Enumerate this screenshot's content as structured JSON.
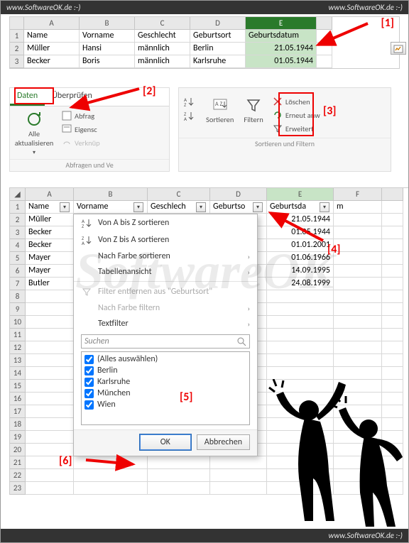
{
  "brand": "www.SoftwareOK.de :-)",
  "watermark": "SoftwareOK",
  "annotations": {
    "a1": "[1]",
    "a2": "[2]",
    "a3": "[3]",
    "a4": "[4]",
    "a5": "[5]",
    "a6": "[6]"
  },
  "sheet1": {
    "cols": [
      "A",
      "B",
      "C",
      "D",
      "E"
    ],
    "header": [
      "Name",
      "Vorname",
      "Geschlecht",
      "Geburtsort",
      "Geburtsdatum"
    ],
    "rows": [
      [
        "Müller",
        "Hansi",
        "männlich",
        "Berlin",
        "21.05.1944"
      ],
      [
        "Becker",
        "Boris",
        "männlich",
        "Karlsruhe",
        "01.05.1944"
      ]
    ]
  },
  "ribbon": {
    "tab_daten": "Daten",
    "tab_ueberpruefen": "Überprüfen",
    "btn_alle_aktualisieren": "Alle aktualisieren",
    "item_abfrag": "Abfrag",
    "item_eigensch": "Eigensc",
    "item_verknuep": "Verknüp",
    "group_abfragen": "Abfragen und Ve",
    "btn_sortieren": "Sortieren",
    "btn_filtern": "Filtern",
    "item_loeschen": "Löschen",
    "item_erneut": "Erneut anw",
    "item_erweitert": "Erweitert",
    "group_sortfilter": "Sortieren und Filtern"
  },
  "sheet2": {
    "cols": [
      "A",
      "B",
      "C",
      "D",
      "E",
      "F"
    ],
    "header": [
      "Name",
      "Vorname",
      "Geschlech",
      "Geburtso",
      "Geburtsda",
      "m"
    ],
    "data": {
      "names": [
        "Müller",
        "Becker",
        "Becker",
        "Mayer",
        "Mayer",
        "Butler"
      ],
      "dates": [
        "21.05.1944",
        "01.05.1944",
        "01.01.2001",
        "01.06.1966",
        "14.09.1995",
        "24.08.1999"
      ]
    }
  },
  "dropdown": {
    "sort_az": "Von A bis Z sortieren",
    "sort_za": "Von Z bis A sortieren",
    "sort_color": "Nach Farbe sortieren",
    "table_view": "Tabellenansicht",
    "clear_filter": "Filter entfernen aus \"Geburtsort\"",
    "color_filter": "Nach Farbe filtern",
    "text_filter": "Textfilter",
    "search_placeholder": "Suchen",
    "select_all": "(Alles auswählen)",
    "options": [
      "Berlin",
      "Karlsruhe",
      "München",
      "Wien"
    ],
    "ok": "OK",
    "cancel": "Abbrechen"
  }
}
